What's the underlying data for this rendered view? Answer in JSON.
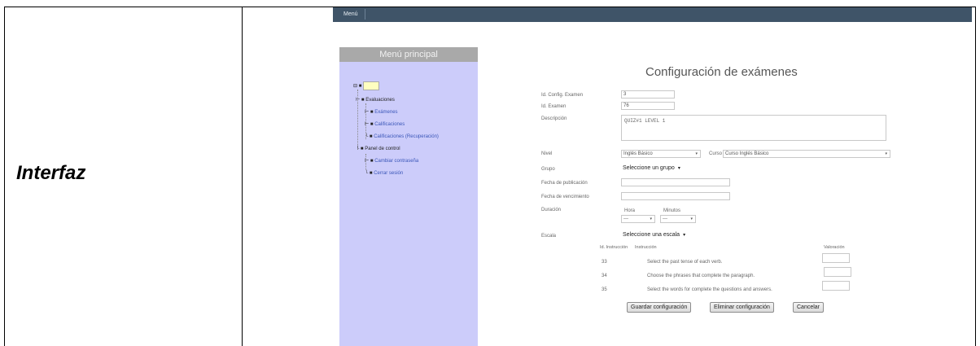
{
  "document": {
    "row_label": "Interfaz"
  },
  "menubar": {
    "items": [
      {
        "label": "Menú"
      }
    ]
  },
  "sidebar": {
    "title": "Menú principal",
    "tree": [
      {
        "label": "Evaluaciones"
      },
      {
        "label": "Exámenes"
      },
      {
        "label": "Calificaciones"
      },
      {
        "label": "Calificaciones (Recuperación)"
      },
      {
        "label": "Panel de control"
      },
      {
        "label": "Cambiar contraseña"
      },
      {
        "label": "Cerrar sesión"
      }
    ]
  },
  "form": {
    "title": "Configuración de exámenes",
    "labels": {
      "id_config": "Id. Config. Examen",
      "id_exam": "Id. Examen",
      "description": "Descripción",
      "level": "Nivel",
      "course": "Curso",
      "group": "Grupo",
      "pub_date": "Fecha de publicación",
      "exp_date": "Fecha de vencimiento",
      "duration": "Duración",
      "hour": "Hora",
      "minutes": "Minutos",
      "scale": "Escala"
    },
    "values": {
      "id_config": "3",
      "id_exam": "76",
      "description": "QUIZ#1 LEVEL 1",
      "level": "Inglés Básico",
      "course": "Curso Inglés Básico",
      "group": "Seleccione un grupo",
      "pub_date": "",
      "exp_date": "",
      "hour": "---",
      "minutes": "---",
      "scale": "Seleccione una escala"
    },
    "instructions": {
      "headers": {
        "id_instruction": "Id. Instrucción",
        "instruction": "Instrucción",
        "valuation": "Valoración"
      },
      "rows": [
        {
          "id": "33",
          "text": "Select the past tense of each verb."
        },
        {
          "id": "34",
          "text": "Choose the phrases that complete the paragraph."
        },
        {
          "id": "35",
          "text": "Select the words for complete the questions and answers."
        }
      ]
    },
    "buttons": {
      "save": "Guardar configuración",
      "delete": "Eliminar configuración",
      "cancel": "Cancelar"
    }
  }
}
